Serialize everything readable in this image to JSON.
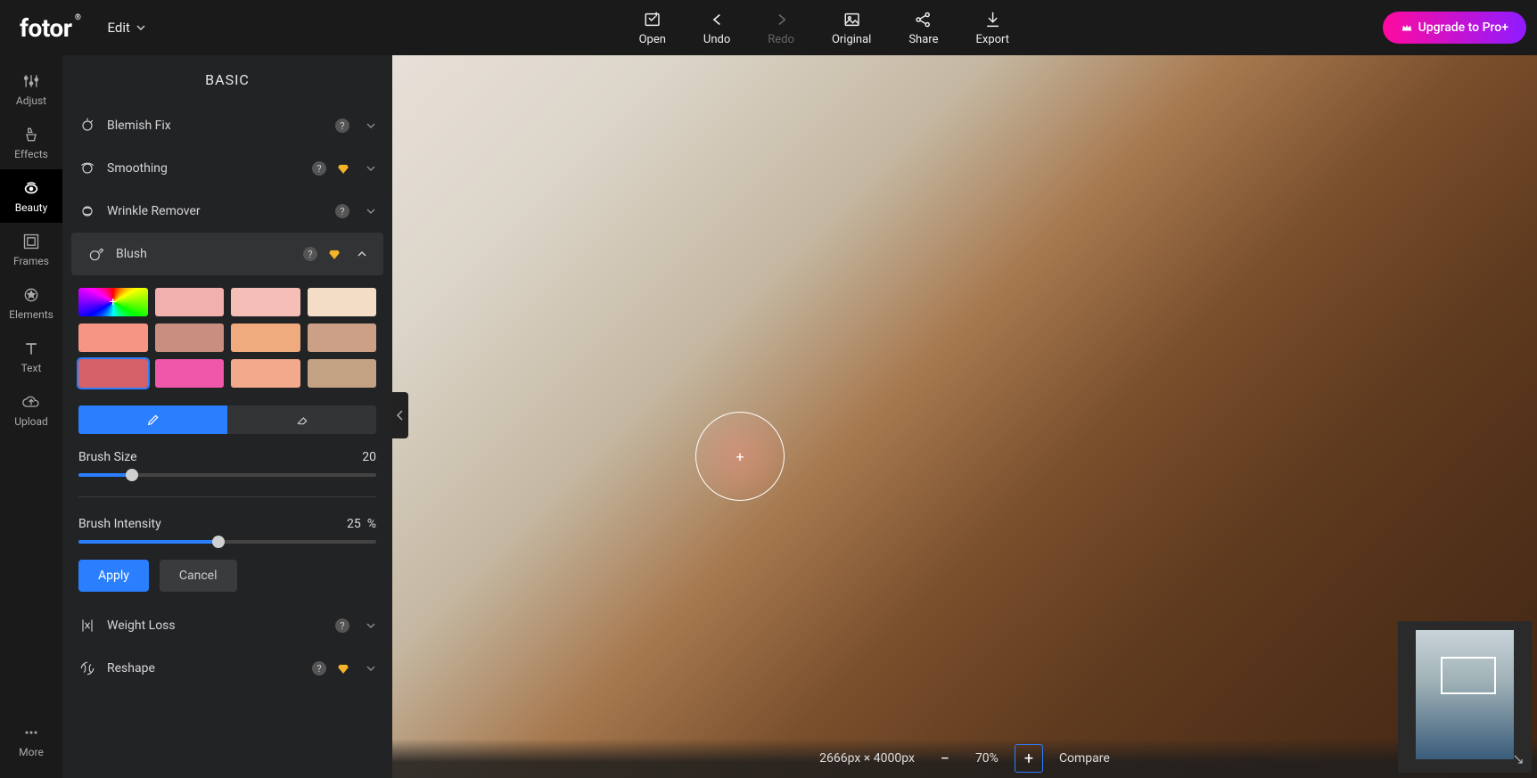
{
  "brand": "fotor",
  "topbar": {
    "edit_label": "Edit",
    "actions": [
      {
        "id": "open",
        "label": "Open",
        "disabled": false
      },
      {
        "id": "undo",
        "label": "Undo",
        "disabled": false
      },
      {
        "id": "redo",
        "label": "Redo",
        "disabled": true
      },
      {
        "id": "original",
        "label": "Original",
        "disabled": false
      },
      {
        "id": "share",
        "label": "Share",
        "disabled": false
      },
      {
        "id": "export",
        "label": "Export",
        "disabled": false
      }
    ],
    "upgrade_label": "Upgrade to Pro+"
  },
  "sidebar": {
    "items": [
      {
        "id": "adjust",
        "label": "Adjust",
        "active": false
      },
      {
        "id": "effects",
        "label": "Effects",
        "active": false
      },
      {
        "id": "beauty",
        "label": "Beauty",
        "active": true
      },
      {
        "id": "frames",
        "label": "Frames",
        "active": false
      },
      {
        "id": "elements",
        "label": "Elements",
        "active": false
      },
      {
        "id": "text",
        "label": "Text",
        "active": false
      },
      {
        "id": "upload",
        "label": "Upload",
        "active": false
      }
    ],
    "more_label": "More"
  },
  "panel": {
    "title": "BASIC",
    "tools": {
      "blemish_fix": "Blemish Fix",
      "smoothing": "Smoothing",
      "wrinkle_remover": "Wrinkle Remover",
      "blush": "Blush",
      "weight_loss": "Weight Loss",
      "reshape": "Reshape"
    },
    "blush": {
      "swatches": [
        {
          "color": "rainbow",
          "selected": false
        },
        {
          "color": "#f2b0ac",
          "selected": false
        },
        {
          "color": "#f5bfb8",
          "selected": false
        },
        {
          "color": "#f3ddc6",
          "selected": false
        },
        {
          "color": "#f69584",
          "selected": false
        },
        {
          "color": "#c98e7f",
          "selected": false
        },
        {
          "color": "#efaa7e",
          "selected": false
        },
        {
          "color": "#cba086",
          "selected": false
        },
        {
          "color": "#d56067",
          "selected": true
        },
        {
          "color": "#f056a9",
          "selected": false
        },
        {
          "color": "#f3a98c",
          "selected": false
        },
        {
          "color": "#c3a284",
          "selected": false
        }
      ],
      "brush_size_label": "Brush Size",
      "brush_size_value": "20",
      "brush_size_pct": 18,
      "brush_intensity_label": "Brush Intensity",
      "brush_intensity_value": "25",
      "brush_intensity_unit": "%",
      "brush_intensity_pct": 47,
      "apply_label": "Apply",
      "cancel_label": "Cancel"
    }
  },
  "canvas": {
    "dim_text": "2666px × 4000px",
    "zoom_level": "70%",
    "compare_label": "Compare"
  },
  "colors": {
    "accent_blue": "#2a7fff",
    "upgrade_gradient_from": "#ff0a9f",
    "upgrade_gradient_to": "#8f1bff",
    "diamond": "#f3b42a"
  }
}
